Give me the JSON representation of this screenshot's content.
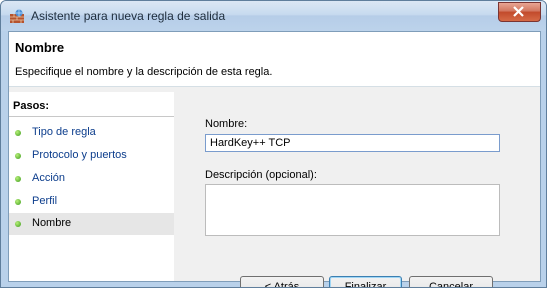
{
  "window": {
    "title": "Asistente para nueva regla de salida"
  },
  "header": {
    "title": "Nombre",
    "description": "Especifique el nombre y la descripción de esta regla."
  },
  "steps": {
    "label": "Pasos:",
    "items": [
      {
        "label": "Tipo de regla",
        "state": "link"
      },
      {
        "label": "Protocolo y puertos",
        "state": "link"
      },
      {
        "label": "Acción",
        "state": "link"
      },
      {
        "label": "Perfil",
        "state": "link"
      },
      {
        "label": "Nombre",
        "state": "current"
      }
    ]
  },
  "form": {
    "name_label": "Nombre:",
    "name_value": "HardKey++ TCP",
    "description_label": "Descripción (opcional):",
    "description_value": ""
  },
  "buttons": {
    "back": "< Atrás",
    "finish": "Finalizar",
    "cancel": "Cancelar"
  },
  "colors": {
    "link": "#0c3d8c",
    "step_dot": "#3a9a1a",
    "close": "#c24a2c"
  }
}
